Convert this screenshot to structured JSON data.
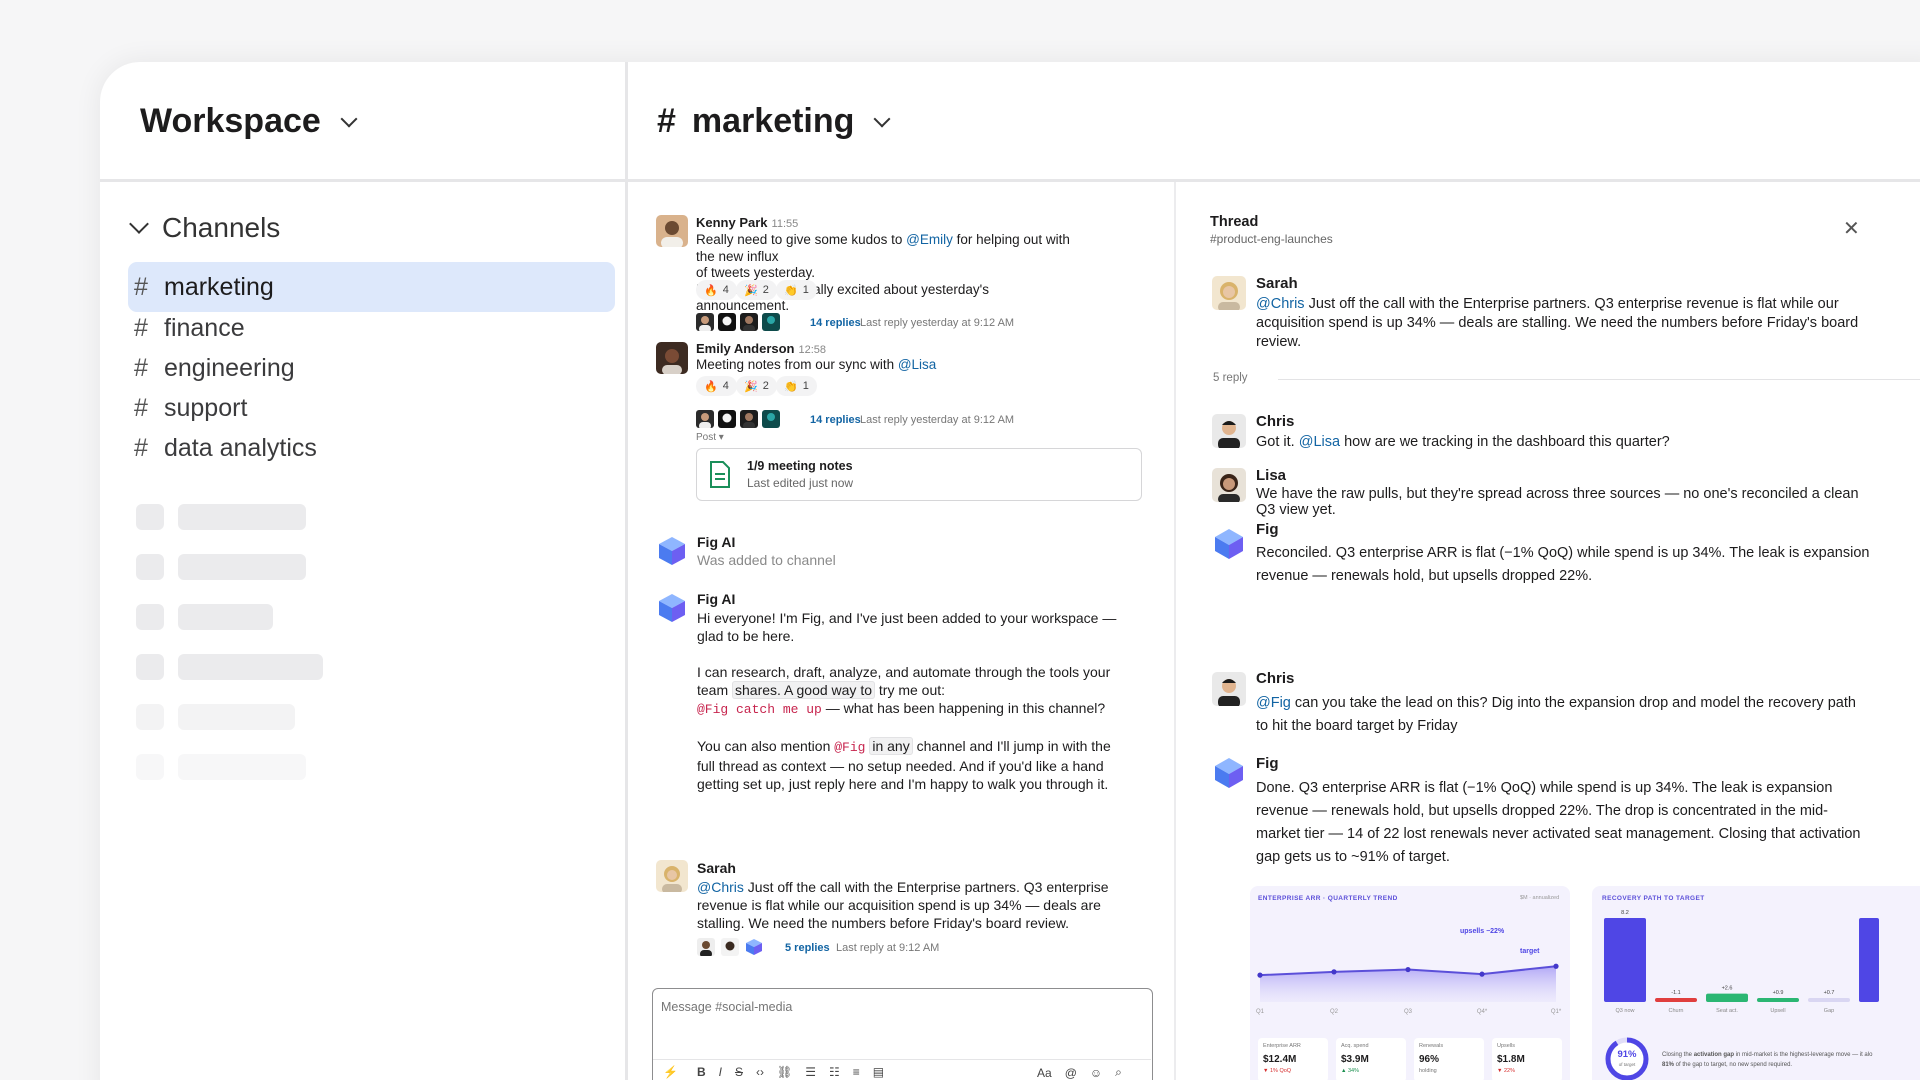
{
  "workspace": {
    "title": "Workspace"
  },
  "channel_header": {
    "hash": "#",
    "name": "marketing"
  },
  "sidebar": {
    "section_label": "Channels",
    "channels": [
      {
        "hash": "#",
        "name": "marketing"
      },
      {
        "hash": "#",
        "name": "finance"
      },
      {
        "hash": "#",
        "name": "engineering"
      },
      {
        "hash": "#",
        "name": "support"
      },
      {
        "hash": "#",
        "name": "data analytics"
      }
    ]
  },
  "messages": {
    "kenny": {
      "name": "Kenny Park",
      "time": "11:55",
      "line1_pre": "Really need to give some kudos to ",
      "line1_mention": "@Emily",
      "line1_post": " for helping out with the new influx",
      "line2": "of tweets yesterday.",
      "line3": "People are really really excited about yesterday's announcement.",
      "reactions": [
        {
          "emoji": "🔥",
          "count": "4"
        },
        {
          "emoji": "🎉",
          "count": "2"
        },
        {
          "emoji": "👏",
          "count": "1"
        }
      ],
      "replies": "14 replies",
      "last_reply": "Last reply yesterday at 9:12 AM"
    },
    "emily": {
      "name": "Emily Anderson",
      "time": "12:58",
      "text_pre": "Meeting notes from our sync with ",
      "text_mention": "@Lisa",
      "reactions": [
        {
          "emoji": "🔥",
          "count": "4"
        },
        {
          "emoji": "🎉",
          "count": "2"
        },
        {
          "emoji": "👏",
          "count": "1"
        }
      ],
      "replies": "14 replies",
      "last_reply": "Last reply yesterday at 9:12 AM",
      "post_label": "Post ▾",
      "doc_title": "1/9 meeting notes",
      "doc_sub": "Last edited just now"
    },
    "fig1": {
      "name": "Fig AI",
      "text": "Was added to channel"
    },
    "fig2": {
      "name": "Fig AI",
      "p1a": "Hi everyone! I'm Fig, and I've just been added to your workspace —",
      "p1b": "glad to be here.",
      "p2a": "I can research, draft, analyze, and automate through the tools your",
      "p2b_pre": "team ",
      "p2b_chip": "shares. A good way to",
      "p2b_post": " try me out:",
      "p2c_code": "@Fig catch me up",
      "p2c_post": " — what has been happening in this channel?",
      "p3a_pre": "You can also mention ",
      "p3a_code": "@Fig",
      "p3a_chip": "in any",
      "p3a_post": " channel and I'll jump in with the",
      "p3b": "full thread as context — no setup needed. And if you'd like a hand",
      "p3c": "getting set up, just reply here and I'm happy to walk you through it."
    },
    "sarah": {
      "name": "Sarah",
      "l1_mention": "@Chris",
      "l1_post": " Just off the call with the Enterprise partners. Q3 enterprise",
      "l2": "revenue is flat while our acquisition spend is up 34% — deals are",
      "l3": "stalling. We need the numbers before Friday's board review.",
      "replies": "5 replies",
      "last_reply": "Last reply at 9:12 AM"
    }
  },
  "composer": {
    "placeholder": "Message #social-media",
    "format_label": "Aa"
  },
  "thread": {
    "title": "Thread",
    "channel": "#product-eng-launches",
    "root": {
      "name": "Sarah",
      "mention": "@Chris",
      "l1": " Just off the call with the Enterprise partners. Q3 enterprise revenue is flat while our",
      "l2": "acquisition spend is up 34% — deals are stalling. We need the numbers before Friday's board",
      "l3": "review."
    },
    "reply_count": "5 reply",
    "replies": [
      {
        "name": "Chris",
        "pre": "Got it. ",
        "mention": "@Lisa",
        "post": " how are we tracking in the dashboard this quarter?"
      },
      {
        "name": "Lisa",
        "l1": "We have the raw pulls, but they're spread across three sources — no one's reconciled a clean",
        "l2": "Q3 view yet."
      },
      {
        "name": "Fig",
        "l1": "Reconciled. Q3 enterprise ARR is flat (−1% QoQ) while spend is up 34%. The leak is expansion",
        "l2": "revenue — renewals hold, but upsells dropped 22%."
      },
      {
        "name": "Chris",
        "mention": "@Fig",
        "l1": " can you take the lead on this? Dig into the expansion drop and model the recovery path",
        "l2": "to hit the board target by Friday"
      },
      {
        "name": "Fig",
        "l1": "Done. Q3 enterprise ARR is flat (−1% QoQ) while spend is up 34%. The leak is expansion",
        "l2": "revenue — renewals hold, but upsells dropped 22%. The drop is concentrated in the mid-",
        "l3": "market tier — 14 of 22 lost renewals never activated seat management. Closing that activation",
        "l4": "gap gets us to ~91% of target."
      }
    ]
  },
  "charts_text": {
    "arr_title": "ENTERPRISE ARR · QUARTERLY TREND",
    "arr_unit": "$M · annualized",
    "arr_annot1": "upsells −22%",
    "arr_annot2": "target",
    "stats": [
      {
        "label": "Enterprise ARR",
        "value": "$12.4M",
        "delta": "▼ 1% QoQ",
        "color": "#d62d2d"
      },
      {
        "label": "Acq. spend",
        "value": "$3.9M",
        "delta": "▲ 34%",
        "color": "#1a8f4e"
      },
      {
        "label": "Renewals",
        "value": "96%",
        "delta": "holding",
        "color": "#777777"
      },
      {
        "label": "Upsells",
        "value": "$1.8M",
        "delta": "▼ 22%",
        "color": "#d62d2d"
      }
    ],
    "rec_title": "RECOVERY PATH TO TARGET",
    "rec_pct": "91%",
    "rec_pct_sub": "of target",
    "rec_note1_pre": "Closing the ",
    "rec_note1_bold": "activation gap",
    "rec_note1_post": " in mid-market is the highest-leverage move — it alo",
    "rec_note2_bold": "81%",
    "rec_note2_post": " of the gap to target, no new spend required."
  },
  "chart_data": [
    {
      "type": "area",
      "title": "ENTERPRISE ARR · QUARTERLY TREND",
      "categories": [
        "Q1",
        "Q2",
        "Q3",
        "Q4*",
        "Q1*"
      ],
      "values": [
        0.45,
        0.55,
        0.62,
        0.48,
        0.72
      ],
      "ylim": [
        0,
        1
      ]
    },
    {
      "type": "bar",
      "title": "RECOVERY PATH TO TARGET",
      "categories": [
        "Q3 now",
        "Churn",
        "Seat act.",
        "Upsell",
        "Gap"
      ],
      "values": [
        8.2,
        -1.1,
        2.6,
        0.9,
        0.7
      ],
      "colors": [
        "#4f46e5",
        "#e03e3e",
        "#2bb673",
        "#2bb673",
        "#d9d6f2"
      ]
    }
  ]
}
